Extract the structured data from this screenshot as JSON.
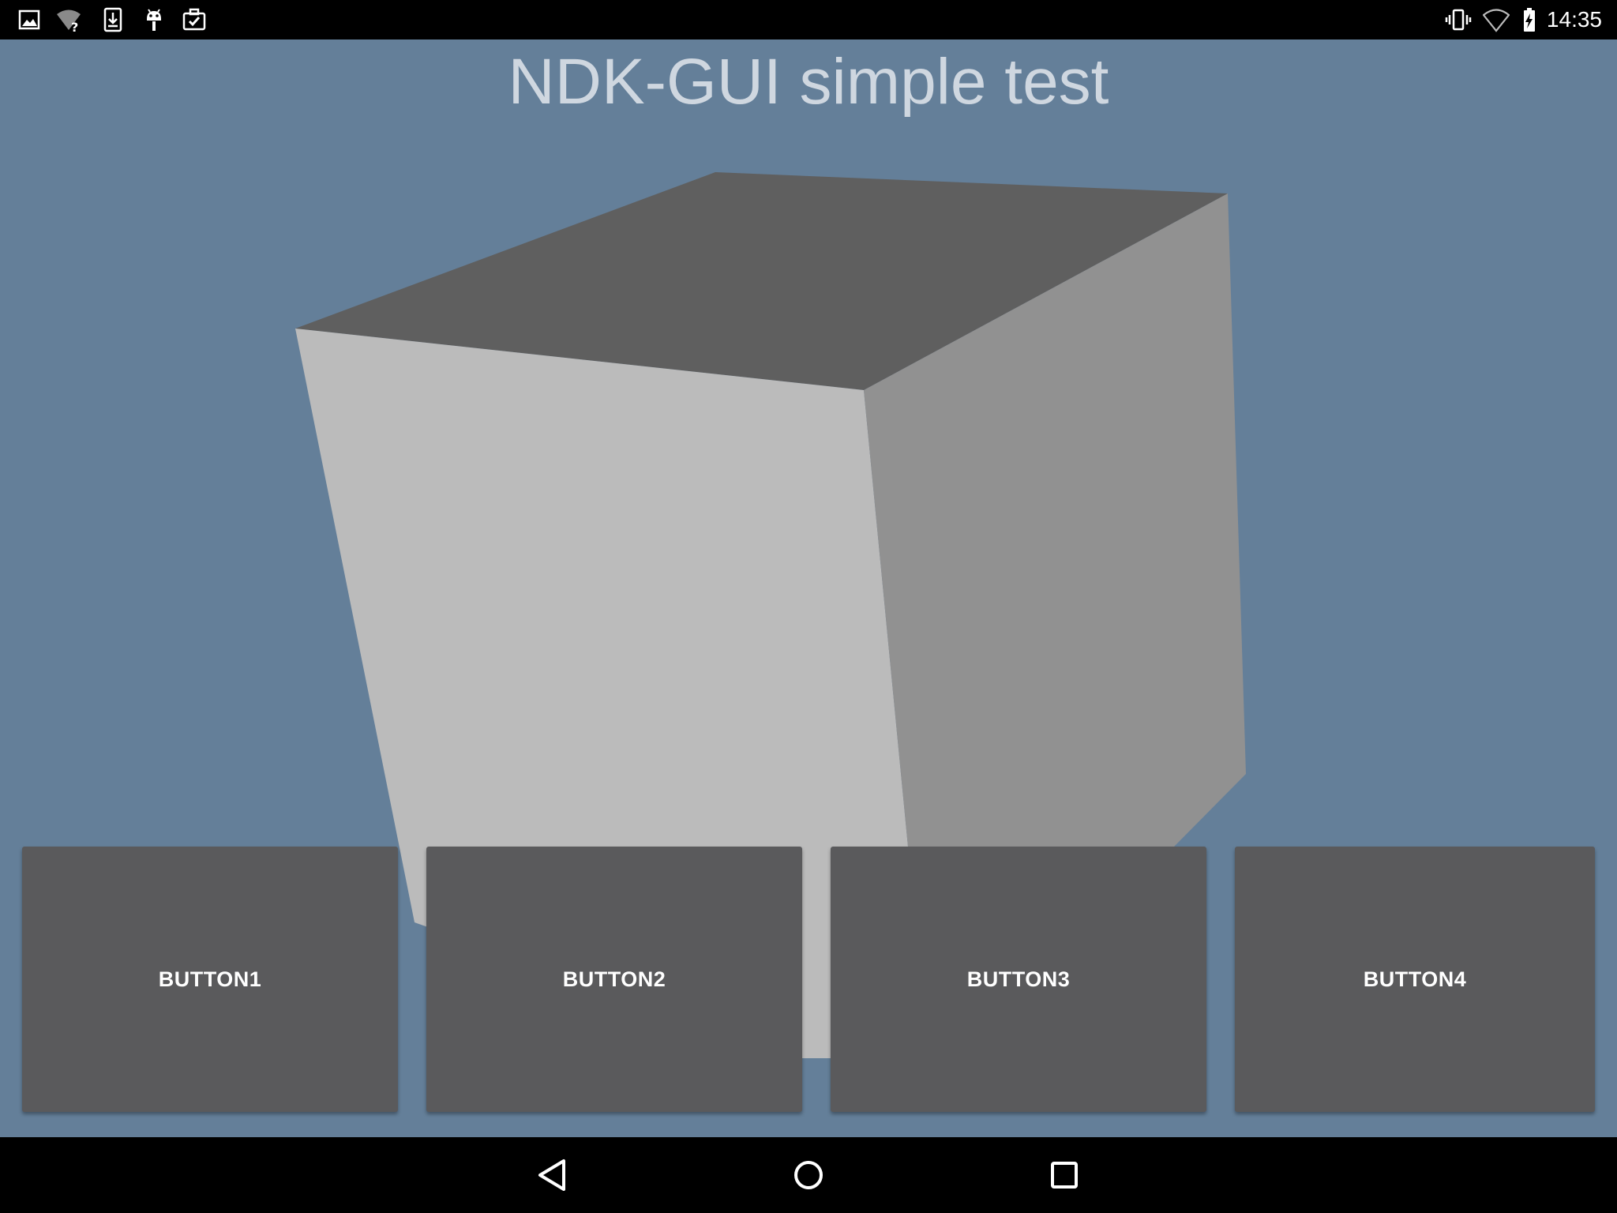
{
  "status_bar": {
    "time": "14:35",
    "left_icons": [
      "image-icon",
      "wifi-unknown-icon",
      "download-icon",
      "android-debug-icon",
      "briefcase-check-icon"
    ],
    "right_icons": [
      "vibrate-icon",
      "wifi-icon",
      "battery-charging-icon"
    ]
  },
  "app": {
    "title": "NDK-GUI simple test",
    "background_color": "#647f99",
    "cube_colors": {
      "top": "#5f5f5f",
      "front": "#bbbbbb",
      "right": "#919191"
    },
    "buttons": [
      {
        "label": "BUTTON1"
      },
      {
        "label": "BUTTON2"
      },
      {
        "label": "BUTTON3"
      },
      {
        "label": "BUTTON4"
      }
    ]
  },
  "nav_bar": {
    "icons": [
      "back-icon",
      "home-icon",
      "recents-icon"
    ]
  }
}
